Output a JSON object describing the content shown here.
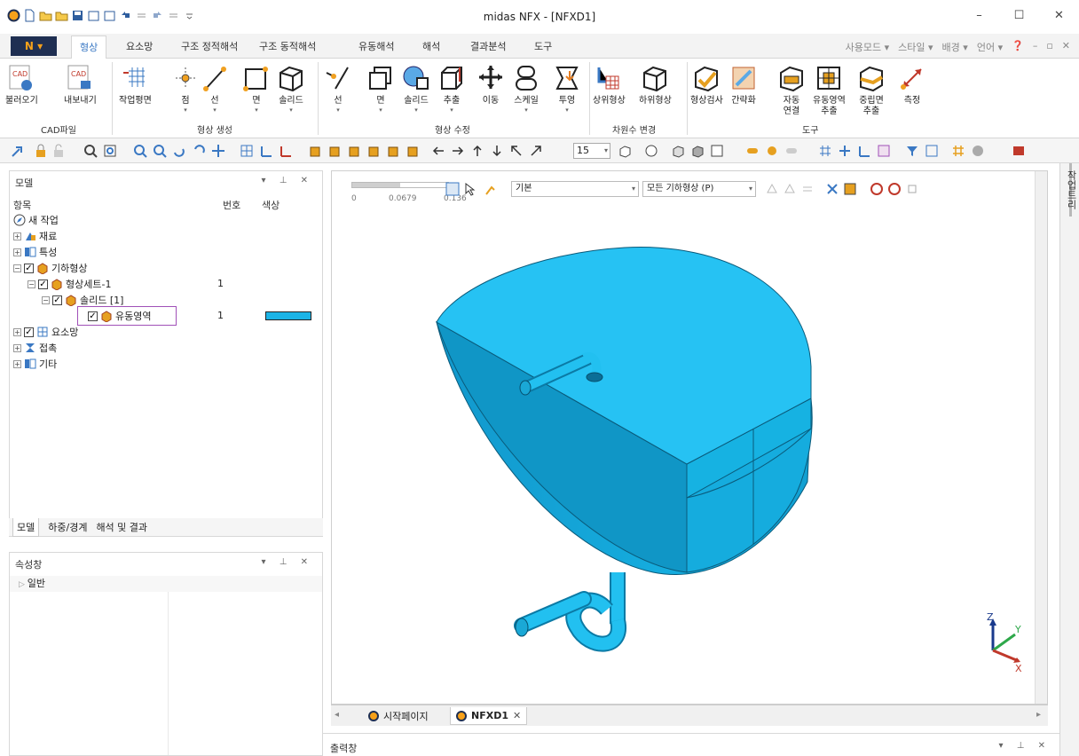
{
  "window": {
    "title": "midas NFX - [NFXD1]"
  },
  "ribbon": {
    "app_button": "N",
    "tabs": [
      "형상",
      "요소망",
      "구조 정적해석",
      "구조 동적해석",
      "유동해석",
      "해석",
      "결과분석",
      "도구"
    ],
    "active_tab": "형상",
    "right_options": [
      "사용모드",
      "스타일",
      "배경",
      "언어"
    ],
    "groups": {
      "cad": {
        "label": "CAD파일",
        "buttons": [
          "불러오기",
          "내보내기"
        ]
      },
      "create": {
        "label": "형상 생성",
        "buttons": [
          "작업평면",
          "점",
          "선",
          "면",
          "솔리드"
        ]
      },
      "modify": {
        "label": "형상 수정",
        "buttons": [
          "선",
          "면",
          "솔리드",
          "추출",
          "이동",
          "스케일",
          "투영"
        ]
      },
      "dimension": {
        "label": "차원수 변경",
        "buttons": [
          "상위형상",
          "하위형상"
        ]
      },
      "tools": {
        "label": "도구",
        "buttons": [
          "형상검사",
          "간략화",
          "자동\n연결",
          "유동영역\n추출",
          "중립면\n추출",
          "측정"
        ]
      }
    }
  },
  "toolbar": {
    "zoom_value": "15"
  },
  "model_panel": {
    "title": "모델",
    "columns": {
      "item": "항목",
      "number": "번호",
      "color": "색상"
    },
    "tree": [
      {
        "label": "새 작업",
        "number": ""
      },
      {
        "label": "재료",
        "number": ""
      },
      {
        "label": "특성",
        "number": ""
      },
      {
        "label": "기하형상",
        "number": ""
      },
      {
        "label": "형상세트-1",
        "number": "1"
      },
      {
        "label": "솔리드 [1]",
        "number": ""
      },
      {
        "label": "유동영역",
        "number": "1",
        "color": "#1cb4e6"
      },
      {
        "label": "요소망",
        "number": ""
      },
      {
        "label": "접촉",
        "number": ""
      },
      {
        "label": "기타",
        "number": ""
      }
    ],
    "bottom_tabs": [
      "모델",
      "하중/경계",
      "해석 및 결과"
    ]
  },
  "property_panel": {
    "title": "속성창",
    "category": "일반"
  },
  "viewport": {
    "scale_labels": [
      "0",
      "0.0679",
      "0.136"
    ],
    "style_select": "기본",
    "filter_select": "모든 기하형상 (P)",
    "axis_labels": {
      "z": "Z",
      "y": "Y",
      "x": "X"
    },
    "model_color": "#1cb4e6"
  },
  "doc_tabs": [
    {
      "label": "시작페이지",
      "active": false
    },
    {
      "label": "NFXD1",
      "active": true
    }
  ],
  "output_panel": {
    "title": "출력창"
  },
  "right_sidebar": {
    "label": "작업트리"
  }
}
